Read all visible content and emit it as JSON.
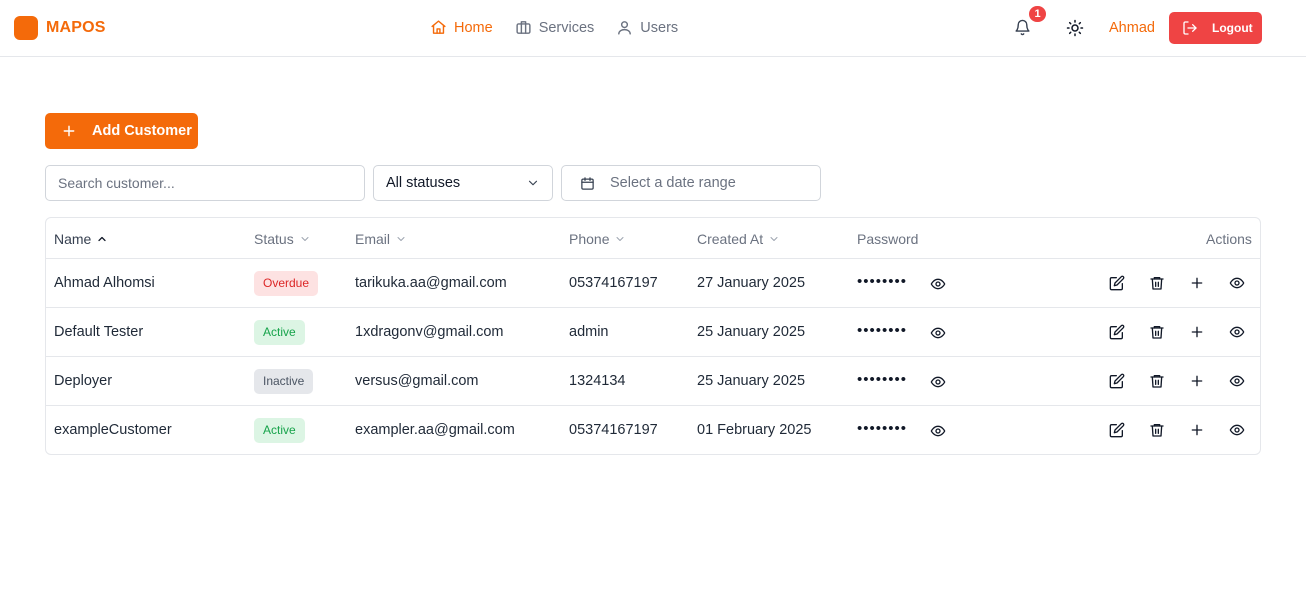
{
  "brand": {
    "name": "MAPOS",
    "color": "#f46a0a"
  },
  "nav": [
    {
      "label": "Home",
      "icon": "home-icon",
      "active": true
    },
    {
      "label": "Services",
      "icon": "briefcase-icon",
      "active": false
    },
    {
      "label": "Users",
      "icon": "user-icon",
      "active": false
    }
  ],
  "header": {
    "notification_count": "1",
    "user_name": "Ahmad",
    "logout_label": "Logout"
  },
  "toolbar": {
    "add_label": "Add Customer",
    "search_placeholder": "Search customer...",
    "status_selected": "All statuses",
    "date_placeholder": "Select a date range"
  },
  "table": {
    "columns": {
      "name": "Name",
      "status": "Status",
      "email": "Email",
      "phone": "Phone",
      "created": "Created At",
      "password": "Password",
      "actions": "Actions"
    },
    "password_mask": "••••••••",
    "rows": [
      {
        "name": "Ahmad Alhomsi",
        "status": "Overdue",
        "status_type": "overdue",
        "email": "tarikuka.aa@gmail.com",
        "phone": "05374167197",
        "created": "27 January 2025"
      },
      {
        "name": "Default Tester",
        "status": "Active",
        "status_type": "active",
        "email": "1xdragonv@gmail.com",
        "phone": "admin",
        "created": "25 January 2025"
      },
      {
        "name": "Deployer",
        "status": "Inactive",
        "status_type": "inactive",
        "email": "versus@gmail.com",
        "phone": "1324134",
        "created": "25 January 2025"
      },
      {
        "name": "exampleCustomer",
        "status": "Active",
        "status_type": "active",
        "email": "exampler.aa@gmail.com",
        "phone": "05374167197",
        "created": "01 February 2025"
      }
    ]
  },
  "colors": {
    "accent": "#f46a0a",
    "danger": "#ef4444",
    "overdue_bg": "#fde2e2",
    "active_bg": "#dcf5e4",
    "inactive_bg": "#e5e7eb"
  }
}
